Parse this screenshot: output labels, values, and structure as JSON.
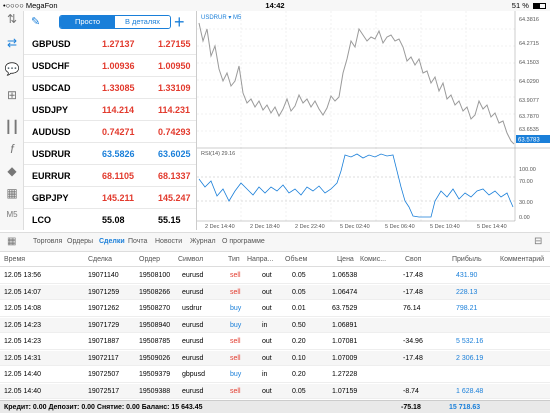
{
  "status_bar": {
    "carrier": "•○○○○ MegaFon",
    "time": "14:42",
    "battery": "51 %",
    "battery_level": 0.51
  },
  "quotes_header": {
    "seg_simple": "Просто",
    "seg_detail": "В деталях"
  },
  "quotes": [
    {
      "symbol": "GBPUSD",
      "bid": "1.27137",
      "ask": "1.27155",
      "color": "red"
    },
    {
      "symbol": "USDCHF",
      "bid": "1.00936",
      "ask": "1.00950",
      "color": "red"
    },
    {
      "symbol": "USDCAD",
      "bid": "1.33085",
      "ask": "1.33109",
      "color": "red"
    },
    {
      "symbol": "USDJPY",
      "bid": "114.214",
      "ask": "114.231",
      "color": "red"
    },
    {
      "symbol": "AUDUSD",
      "bid": "0.74271",
      "ask": "0.74293",
      "color": "red"
    },
    {
      "symbol": "USDRUR",
      "bid": "63.5826",
      "ask": "63.6025",
      "color": "blue"
    },
    {
      "symbol": "EURRUR",
      "bid": "68.1105",
      "ask": "68.1337",
      "color": "red"
    },
    {
      "symbol": "GBPJPY",
      "bid": "145.211",
      "ask": "145.247",
      "color": "red"
    },
    {
      "symbol": "LCO",
      "bid": "55.08",
      "ask": "55.15",
      "color": "black"
    }
  ],
  "chart": {
    "title": "USDRUR ▾ M5",
    "price_ticks": [
      "64.3816",
      "64.2715",
      "64.1503",
      "64.0290",
      "63.9077",
      "63.7870",
      "63.6535",
      "63.5783"
    ],
    "current_price": "63.5783",
    "rsi_label": "RSI(14) 29.16",
    "rsi_ticks": [
      "100.00",
      "70.00",
      "30.00",
      "0.00"
    ],
    "time_ticks": [
      "2 Dec 14:40",
      "2 Dec 18:40",
      "2 Dec 22:40",
      "5 Dec 02:40",
      "5 Dec 06:40",
      "5 Dec 10:40",
      "5 Dec 14:40"
    ]
  },
  "tabs": [
    "Торговля",
    "Ордеры",
    "Сделки",
    "Почта",
    "Новости",
    "Журнал",
    "О программе"
  ],
  "active_tab": "Сделки",
  "table": {
    "headers": [
      "Время",
      "Сделка",
      "Ордер",
      "Символ",
      "Тип",
      "Напра...",
      "Объем",
      "Цена",
      "Комис...",
      "Своп",
      "Прибыль",
      "Комментарий"
    ],
    "rows": [
      {
        "time": "12.05 13:56",
        "deal": "19071140",
        "order": "19508100",
        "symbol": "eurusd",
        "type": "sell",
        "dir": "out",
        "volume": "0.05",
        "price": "1.06538",
        "commission": "",
        "swap": "-17.48",
        "profit": "431.90"
      },
      {
        "time": "12.05 14:07",
        "deal": "19071259",
        "order": "19508266",
        "symbol": "eurusd",
        "type": "sell",
        "dir": "out",
        "volume": "0.05",
        "price": "1.06474",
        "commission": "",
        "swap": "-17.48",
        "profit": "228.13"
      },
      {
        "time": "12.05 14:08",
        "deal": "19071262",
        "order": "19508270",
        "symbol": "usdrur",
        "type": "buy",
        "dir": "out",
        "volume": "0.01",
        "price": "63.7529",
        "commission": "",
        "swap": "76.14",
        "profit": "798.21"
      },
      {
        "time": "12.05 14:23",
        "deal": "19071729",
        "order": "19508940",
        "symbol": "eurusd",
        "type": "buy",
        "dir": "in",
        "volume": "0.50",
        "price": "1.06891",
        "commission": "",
        "swap": "",
        "profit": ""
      },
      {
        "time": "12.05 14:23",
        "deal": "19071887",
        "order": "19508785",
        "symbol": "eurusd",
        "type": "sell",
        "dir": "out",
        "volume": "0.20",
        "price": "1.07081",
        "commission": "",
        "swap": "-34.96",
        "profit": "5 532.16"
      },
      {
        "time": "12.05 14:31",
        "deal": "19072117",
        "order": "19509026",
        "symbol": "eurusd",
        "type": "sell",
        "dir": "out",
        "volume": "0.10",
        "price": "1.07009",
        "commission": "",
        "swap": "-17.48",
        "profit": "2 306.19"
      },
      {
        "time": "12.05 14:40",
        "deal": "19072507",
        "order": "19509379",
        "symbol": "gbpusd",
        "type": "buy",
        "dir": "in",
        "volume": "0.20",
        "price": "1.27228",
        "commission": "",
        "swap": "",
        "profit": ""
      },
      {
        "time": "12.05 14:40",
        "deal": "19072517",
        "order": "19509388",
        "symbol": "eurusd",
        "type": "sell",
        "dir": "out",
        "volume": "0.05",
        "price": "1.07159",
        "commission": "",
        "swap": "-8.74",
        "profit": "1 628.48"
      }
    ]
  },
  "footer": {
    "summary": "Кредит: 0.00 Депозит: 0.00 Снятие: 0.00 Баланс: 15 643.45",
    "swap_total": "-75.18",
    "profit_total": "15 718.63"
  },
  "colors": {
    "accent": "#1a7fd9",
    "sell": "#e23a2d",
    "buy": "#1a7fd9"
  }
}
